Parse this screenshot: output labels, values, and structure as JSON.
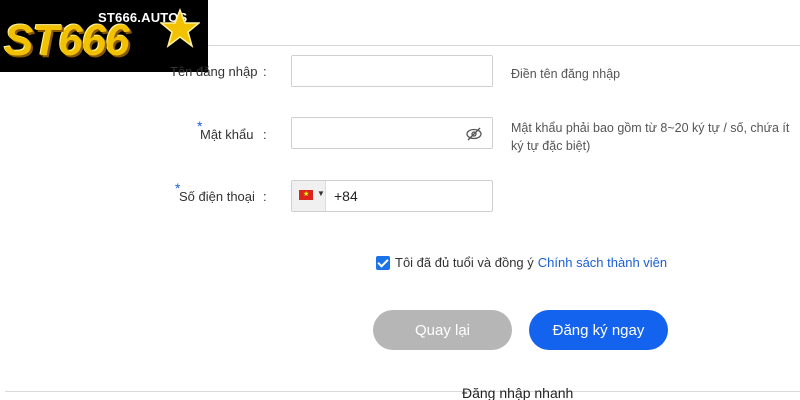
{
  "logo": {
    "domain": "ST666.AUTOS",
    "wordmark": "ST666"
  },
  "form": {
    "username": {
      "label": "Tên đăng nhập",
      "colon": ":",
      "value": "",
      "hint": "Điền tên đăng nhập"
    },
    "password": {
      "label": "Mật khẩu",
      "colon": ":",
      "required_mark": "*",
      "value": "",
      "hint_line1": "Mật khẩu phải bao gồm từ 8~20 ký tự / số, chứa ít",
      "hint_line2": "ký tự đặc biệt)",
      "eye_icon": "eye-off-icon"
    },
    "phone": {
      "label": "Số điện thoại",
      "colon": ":",
      "required_mark": "*",
      "country_flag": "vietnam-flag-icon",
      "value": "+84"
    }
  },
  "agreement": {
    "checked": true,
    "text": "Tôi đã đủ tuổi và đồng ý",
    "link": "Chính sách thành viên"
  },
  "buttons": {
    "back": "Quay lại",
    "register": "Đăng ký ngay"
  },
  "quick_login": "Đăng nhập nhanh",
  "colors": {
    "primary": "#1463ee",
    "secondary": "#b6b6b6",
    "link": "#1a5fd6",
    "logo_gold": "#f2c200"
  }
}
